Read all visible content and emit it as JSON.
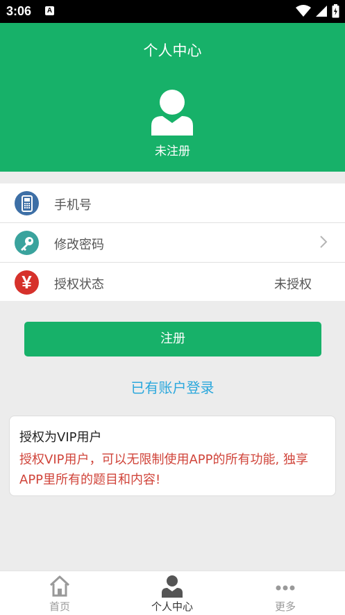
{
  "status_bar": {
    "time": "3:06",
    "notification_badge": "A"
  },
  "header": {
    "title": "个人中心",
    "user_name": "未注册"
  },
  "menu": [
    {
      "label": "手机号",
      "icon": "phone-icon",
      "icon_color": "#3d6fa6",
      "value": ""
    },
    {
      "label": "修改密码",
      "icon": "key-icon",
      "icon_color": "#3aa39d",
      "value": ""
    },
    {
      "label": "授权状态",
      "icon": "yen-icon",
      "icon_color": "#d6312b",
      "value": "未授权"
    }
  ],
  "register_button": "注册",
  "login_link": "已有账户登录",
  "vip_card": {
    "title": "授权为VIP用户",
    "description": "授权VIP用户，可以无限制使用APP的所有功能, 独享APP里所有的题目和内容!"
  },
  "tabs": [
    {
      "label": "首页",
      "icon": "home-icon",
      "active": false
    },
    {
      "label": "个人中心",
      "icon": "person-icon",
      "active": true
    },
    {
      "label": "更多",
      "icon": "more-icon",
      "active": false
    }
  ],
  "colors": {
    "primary": "#17b169",
    "link": "#2aa7dc",
    "warning_text": "#d0443a"
  }
}
